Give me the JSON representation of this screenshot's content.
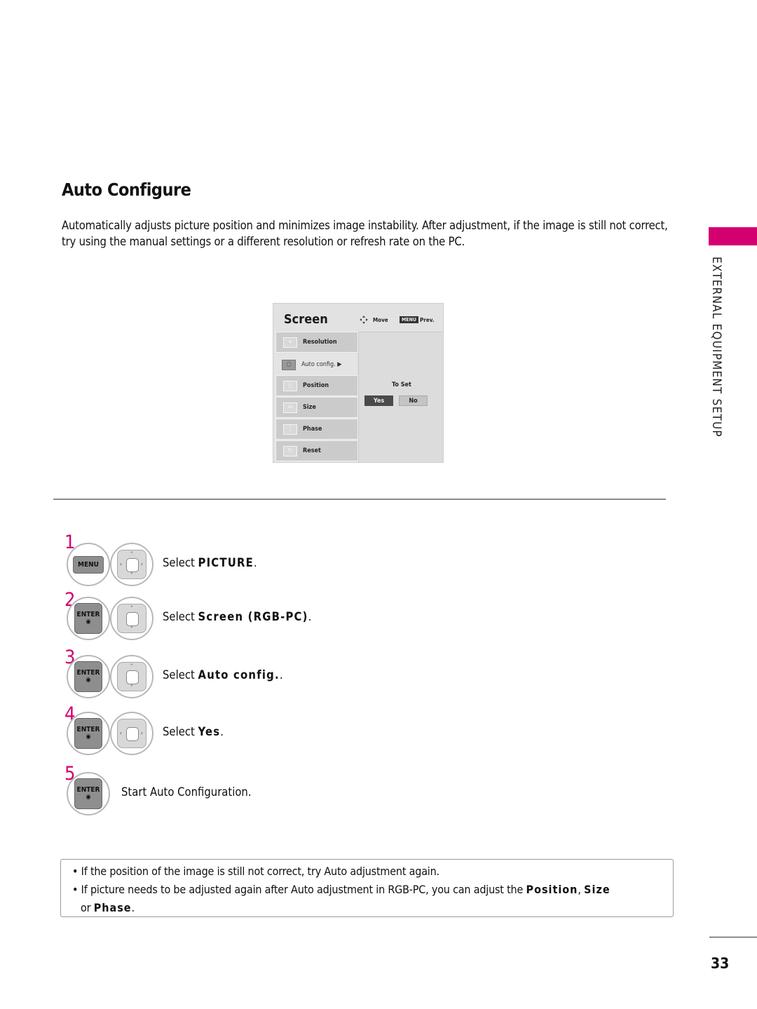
{
  "page": {
    "title": "Auto Configure",
    "intro": "Automatically adjusts picture position and minimizes image instability. After adjustment, if the image is still not correct, try using the manual settings or a different resolution or refresh rate on the PC.",
    "section_label": "EXTERNAL EQUIPMENT SETUP",
    "page_number": "33",
    "accent_color": "#d4006f"
  },
  "osd": {
    "title": "Screen",
    "hint_move": "Move",
    "hint_menu_key": "MENU",
    "hint_prev": "Prev.",
    "items": [
      {
        "label": "Resolution",
        "icon": "resolution-icon",
        "glyph": "+"
      },
      {
        "label": "Auto config. ▶",
        "icon": "auto-config-icon",
        "glyph": "○",
        "active": true
      },
      {
        "label": "Position",
        "icon": "position-icon",
        "glyph": "◇"
      },
      {
        "label": "Size",
        "icon": "size-icon",
        "glyph": "↔"
      },
      {
        "label": "Phase",
        "icon": "phase-icon",
        "glyph": "┆"
      },
      {
        "label": "Reset",
        "icon": "reset-icon",
        "glyph": "↻"
      }
    ],
    "to_set_label": "To Set",
    "yes_label": "Yes",
    "no_label": "No"
  },
  "steps": [
    {
      "number": "1",
      "key": "MENU",
      "nav": "four-way",
      "prefix": "Select ",
      "bold": "PICTURE",
      "suffix": "."
    },
    {
      "number": "2",
      "key": "ENTER",
      "nav": "up-down",
      "prefix": "Select ",
      "bold": "Screen (RGB-PC)",
      "suffix": "."
    },
    {
      "number": "3",
      "key": "ENTER",
      "nav": "up-down",
      "prefix": "Select ",
      "bold": "Auto config.",
      "suffix": "."
    },
    {
      "number": "4",
      "key": "ENTER",
      "nav": "left-right",
      "prefix": "Select ",
      "bold": "Yes",
      "suffix": "."
    },
    {
      "number": "5",
      "key": "ENTER",
      "nav": "none",
      "prefix": "Start Auto Configuration.",
      "bold": "",
      "suffix": ""
    }
  ],
  "keys": {
    "enter_dot": "◉",
    "up": "˄",
    "down": "˅",
    "left": "‹",
    "right": "›"
  },
  "notes": {
    "note1": "• If the position of the image is still not correct, try Auto adjustment again.",
    "note2_prefix": "• If picture needs to be adjusted again after Auto adjustment in RGB-PC, you can adjust the ",
    "note2_b1": "Position",
    "note2_sep1": ", ",
    "note2_b2": "Size",
    "note2_line2_prefix": "or ",
    "note2_b3": "Phase",
    "note2_end": "."
  }
}
